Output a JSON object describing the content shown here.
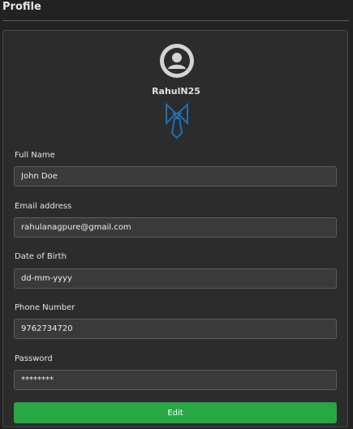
{
  "page": {
    "title": "Profile"
  },
  "profile": {
    "username": "RahulN25",
    "avatar_icon": "user-circle-icon",
    "badge_icon": "tie-icon",
    "badge_color": "#1f6fb5"
  },
  "form": {
    "full_name": {
      "label": "Full Name",
      "value": "John Doe"
    },
    "email": {
      "label": "Email address",
      "value": "rahulanagpure@gmail.com"
    },
    "dob": {
      "label": "Date of Birth",
      "placeholder": "dd-mm-yyyy"
    },
    "phone": {
      "label": "Phone Number",
      "value": "9762734720"
    },
    "password": {
      "label": "Password",
      "value": "********"
    },
    "edit_label": "Edit"
  },
  "colors": {
    "background": "#222222",
    "card": "#2c2c2c",
    "input": "#3a3a3a",
    "button": "#28a745"
  }
}
